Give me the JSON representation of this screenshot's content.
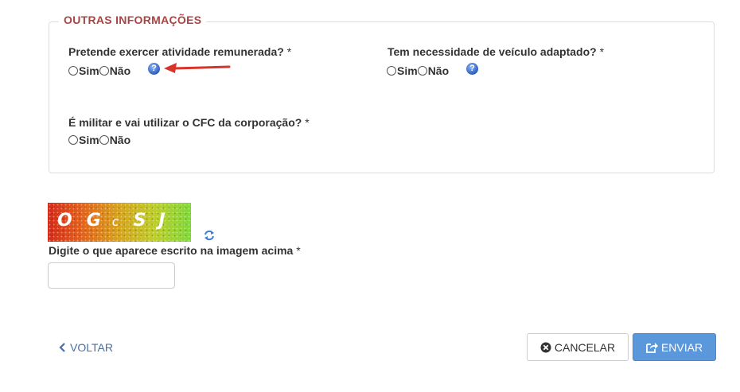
{
  "section": {
    "legend": "OUTRAS INFORMAÇÕES"
  },
  "questions": [
    {
      "label": "Pretende exercer atividade remunerada?",
      "required_mark": "*",
      "yes": "Sim",
      "no": "Não"
    },
    {
      "label": "Tem necessidade de veículo adaptado?",
      "required_mark": "*",
      "yes": "Sim",
      "no": "Não"
    },
    {
      "label": "É militar e vai utilizar o CFC da corporação?",
      "required_mark": "*",
      "yes": "Sim",
      "no": "Não"
    }
  ],
  "help_icon_glyph": "?",
  "captcha": {
    "image_text": [
      "O",
      "G",
      "c",
      "S",
      "J"
    ],
    "label": "Digite o que aparece escrito na imagem acima",
    "required_mark": "*",
    "input_value": ""
  },
  "footer": {
    "back_label": "VOLTAR",
    "back_icon": "chevron-left-icon",
    "cancel_label": "CANCELAR",
    "cancel_icon": "circle-times-icon",
    "send_label": "ENVIAR",
    "send_icon": "share-square-icon"
  },
  "colors": {
    "legend": "#a94442",
    "primary_button": "#5a97db",
    "link": "#4a6fa5",
    "arrow": "#d9342b"
  }
}
